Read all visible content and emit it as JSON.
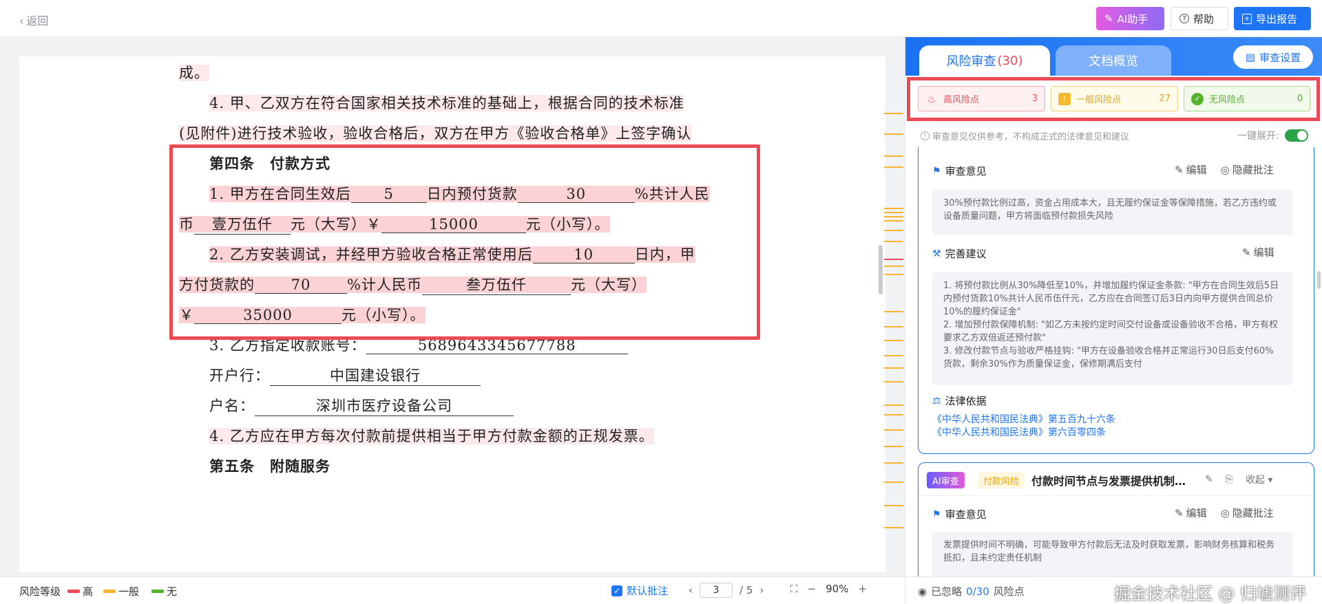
{
  "topbar": {
    "back_label": "返回",
    "ai_label": "AI助手",
    "help_label": "帮助",
    "export_label": "导出报告"
  },
  "document": {
    "lines": {
      "l1": "成。",
      "l2": "4. 甲、乙双方在符合国家相关技术标准的基础上，根据合同的技术标准",
      "l3": "(见附件)进行技术验收，验收合格后，双方在甲方《验收合格单》上签字确认",
      "l4": "第四条　付款方式",
      "l5a": "1. 甲方在合同生效后",
      "l5b": "5",
      "l5c": "日内预付货款",
      "l5d": "30",
      "l5e": "%共计人民",
      "l6a": "币",
      "l6b": "壹万伍仟",
      "l6c": "元（大写）￥",
      "l6d": "15000",
      "l6e": "元（小写）。",
      "l7a": "2. 乙方安装调试，并经甲方验收合格正常使用后",
      "l7b": "10",
      "l7c": "日内，甲",
      "l8a": "方付货款的",
      "l8b": "70",
      "l8c": "%计人民币",
      "l8d": "叁万伍仟",
      "l8e": "元（大写）",
      "l9a": "￥",
      "l9b": "35000",
      "l9c": "元（小写）。",
      "l10a": "3. 乙方指定收款账号：",
      "l10b": "5689643345677788",
      "l11a": "开户行：",
      "l11b": "中国建设银行",
      "l12a": "户名：",
      "l12b": "深圳市医疗设备公司",
      "l13": "4. 乙方应在甲方每次付款前提供相当于甲方付款金额的正规发票。",
      "l14": "第五条　附随服务"
    }
  },
  "bottombar": {
    "legend_title": "风险等级",
    "legend_high": "高",
    "legend_mid": "一般",
    "legend_none": "无",
    "default_annot": "默认批注",
    "page_current": "3",
    "page_total": "/ 5",
    "zoom": "90%",
    "colors": {
      "high": "#ec4b55",
      "mid": "#f7b32b",
      "none": "#52b32b"
    }
  },
  "panel": {
    "tab_risk": "风险审查",
    "tab_risk_count": "(30)",
    "tab_overview": "文档概览",
    "review_settings": "审查设置",
    "chips": {
      "high_label": "高风险点",
      "high_count": "3",
      "mid_label": "一般风险点",
      "mid_count": "27",
      "none_label": "无风险点",
      "none_count": "0"
    },
    "notice": "审查意见仅供参考，不构成正式的法律意见和建议",
    "expand_label": "一键展开:",
    "card1": {
      "opinion_title": "审查意见",
      "edit": "编辑",
      "hide": "隐藏批注",
      "opinion_text": "30%预付款比例过高，资金占用成本大，且无履约保证金等保障措施，若乙方违约或设备质量问题，甲方将面临预付款损失风险",
      "suggest_title": "完善建议",
      "suggest_text_1": "1. 将预付款比例从30%降低至10%，并增加履约保证金条款: \"甲方在合同生效后5日内预付货款10%共计人民币伍仟元，乙方应在合同签订后3日内向甲方提供合同总价10%的履约保证金\"",
      "suggest_text_2": "2. 增加预付款保障机制: \"如乙方未按约定时间交付设备或设备验收不合格，甲方有权要求乙方双倍返还预付款\"",
      "suggest_text_3": "3. 修改付款节点与验收严格挂钩: \"甲方在设备验收合格并正常运行30日后支付60%货款，剩余30%作为质量保证金，保修期满后支付",
      "law_title": "法律依据",
      "law_1": "《中华人民共和国民法典》第五百九十六条",
      "law_2": "《中华人民共和国民法典》第六百零四条"
    },
    "card2": {
      "ai_tag": "AI审查",
      "risk_tag": "付款风险",
      "title": "付款时间节点与发票提供机制不...",
      "collapse": "收起",
      "opinion_title": "审查意见",
      "edit": "编辑",
      "hide": "隐藏批注",
      "opinion_text": "发票提供时间不明确，可能导致甲方付款后无法及时获取发票，影响财务核算和税务抵扣，且未约定责任机制"
    },
    "bottom": {
      "ignored_prefix": "已忽略",
      "ignored_count": "0/30",
      "ignored_suffix": "风险点",
      "watermark": "掘金技术社区 @ 归墟测评"
    }
  }
}
